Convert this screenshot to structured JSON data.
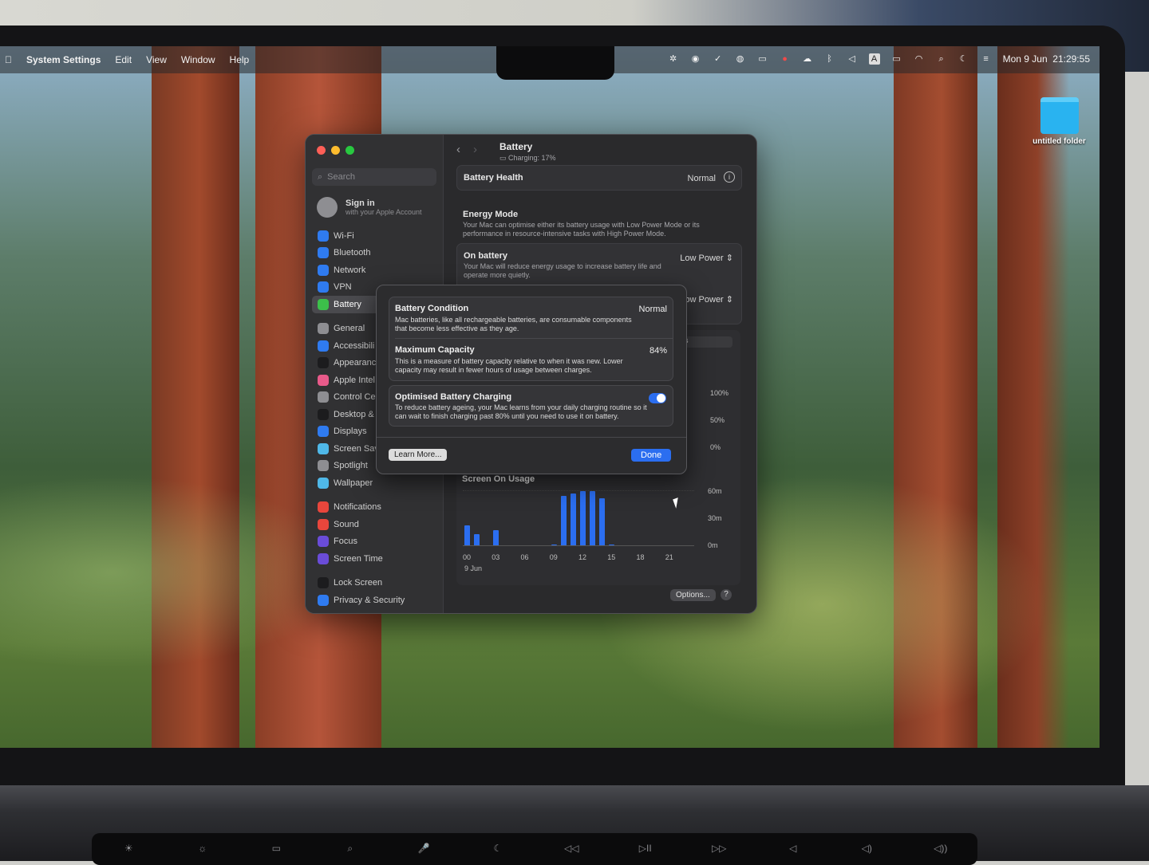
{
  "menubar": {
    "app": "System Settings",
    "menus": [
      "Edit",
      "View",
      "Window",
      "Help"
    ],
    "datetime": "Mon 9 Jun  21:29:55",
    "status_icons": [
      "gear-icon",
      "game-icon",
      "check-icon",
      "globe-icon",
      "window-icon",
      "shield-icon",
      "cloud-icon",
      "bluetooth-icon",
      "mute-icon",
      "input-source-icon",
      "battery-icon",
      "wifi-icon",
      "search-icon",
      "moon-icon",
      "control-center-icon"
    ],
    "input_source": "A"
  },
  "desktop": {
    "folder_label": "untitled folder"
  },
  "sidebar": {
    "search_placeholder": "Search",
    "signin_title": "Sign in",
    "signin_sub": "with your Apple Account",
    "groups": [
      [
        {
          "label": "Wi-Fi",
          "color": "#2f7bf0",
          "icon": "wifi-icon"
        },
        {
          "label": "Bluetooth",
          "color": "#2f7bf0",
          "icon": "bluetooth-icon"
        },
        {
          "label": "Network",
          "color": "#2f7bf0",
          "icon": "globe-icon"
        },
        {
          "label": "VPN",
          "color": "#2f7bf0",
          "icon": "vpn-icon"
        },
        {
          "label": "Battery",
          "color": "#3cc04a",
          "icon": "battery-icon",
          "active": true
        }
      ],
      [
        {
          "label": "General",
          "color": "#8e8e92",
          "icon": "gear-icon"
        },
        {
          "label": "Accessibili",
          "color": "#2f7bf0",
          "icon": "accessibility-icon"
        },
        {
          "label": "Appearanc",
          "color": "#1c1c1e",
          "icon": "appearance-icon"
        },
        {
          "label": "Apple Intel",
          "color": "#e85a8a",
          "icon": "apple-intelligence-icon"
        },
        {
          "label": "Control Ce",
          "color": "#8e8e92",
          "icon": "control-center-icon"
        },
        {
          "label": "Desktop &",
          "color": "#1c1c1e",
          "icon": "desktop-icon"
        },
        {
          "label": "Displays",
          "color": "#2f7bf0",
          "icon": "display-icon"
        },
        {
          "label": "Screen Sav",
          "color": "#4fb8e8",
          "icon": "screensaver-icon"
        },
        {
          "label": "Spotlight",
          "color": "#8e8e92",
          "icon": "spotlight-icon"
        },
        {
          "label": "Wallpaper",
          "color": "#4fb8e8",
          "icon": "wallpaper-icon"
        }
      ],
      [
        {
          "label": "Notifications",
          "color": "#e8463c",
          "icon": "bell-icon"
        },
        {
          "label": "Sound",
          "color": "#e8463c",
          "icon": "speaker-icon"
        },
        {
          "label": "Focus",
          "color": "#6a4cd8",
          "icon": "moon-icon"
        },
        {
          "label": "Screen Time",
          "color": "#6a4cd8",
          "icon": "hourglass-icon"
        }
      ],
      [
        {
          "label": "Lock Screen",
          "color": "#1c1c1e",
          "icon": "lock-icon"
        },
        {
          "label": "Privacy & Security",
          "color": "#2f7bf0",
          "icon": "hand-icon"
        }
      ]
    ]
  },
  "content": {
    "title": "Battery",
    "subtitle": "Charging: 17%",
    "health_label": "Battery Health",
    "health_value": "Normal",
    "energy_title": "Energy Mode",
    "energy_desc": "Your Mac can optimise either its battery usage with Low Power Mode or its performance in resource-intensive tasks with High Power Mode.",
    "on_battery_label": "On battery",
    "on_battery_desc": "Your Mac will reduce energy usage to increase battery life and operate more quietly.",
    "on_battery_value": "Low Power",
    "adapter_value_partial": "ow Power",
    "tab_partial": "s",
    "battery_chart_yticks": [
      "100%",
      "50%",
      "0%"
    ],
    "usage_title": "Screen On Usage",
    "usage_yticks": [
      "60m",
      "30m",
      "0m"
    ],
    "usage_xticks": [
      "00",
      "03",
      "06",
      "09",
      "12",
      "15",
      "18",
      "21"
    ],
    "usage_date": "9 Jun",
    "options_label": "Options...",
    "help_label": "?"
  },
  "chart_data": {
    "type": "bar",
    "title": "Screen On Usage",
    "x_unit": "hour",
    "categories": [
      "00",
      "01",
      "02",
      "03",
      "04",
      "05",
      "06",
      "07",
      "08",
      "09",
      "10",
      "11",
      "12",
      "13",
      "14",
      "15",
      "16",
      "17",
      "18",
      "19",
      "20",
      "21",
      "22",
      "23"
    ],
    "values": [
      22,
      12,
      0,
      17,
      0,
      0,
      0,
      0,
      0,
      1,
      55,
      57,
      60,
      60,
      52,
      1,
      0,
      0,
      0,
      0,
      0,
      0,
      0,
      0
    ],
    "ylim": [
      0,
      60
    ],
    "yunit": "minutes"
  },
  "modal": {
    "rows": [
      {
        "label": "Battery Condition",
        "value": "Normal",
        "desc": "Mac batteries, like all rechargeable batteries, are consumable components that become less effective as they age."
      },
      {
        "label": "Maximum Capacity",
        "value": "84%",
        "desc": "This is a measure of battery capacity relative to when it was new. Lower capacity may result in fewer hours of usage between charges."
      }
    ],
    "optimised_label": "Optimised Battery Charging",
    "optimised_desc": "To reduce battery ageing, your Mac learns from your daily charging routine so it can wait to finish charging past 80% until you need to use it on battery.",
    "optimised_on": true,
    "learn_more": "Learn More...",
    "done": "Done"
  },
  "keyboard": {
    "keys": [
      "☀",
      "☼",
      "▭",
      "⌕",
      "🎤",
      "☾",
      "◁◁",
      "▷II",
      "▷▷",
      "◁",
      "◁)",
      "◁))"
    ]
  }
}
